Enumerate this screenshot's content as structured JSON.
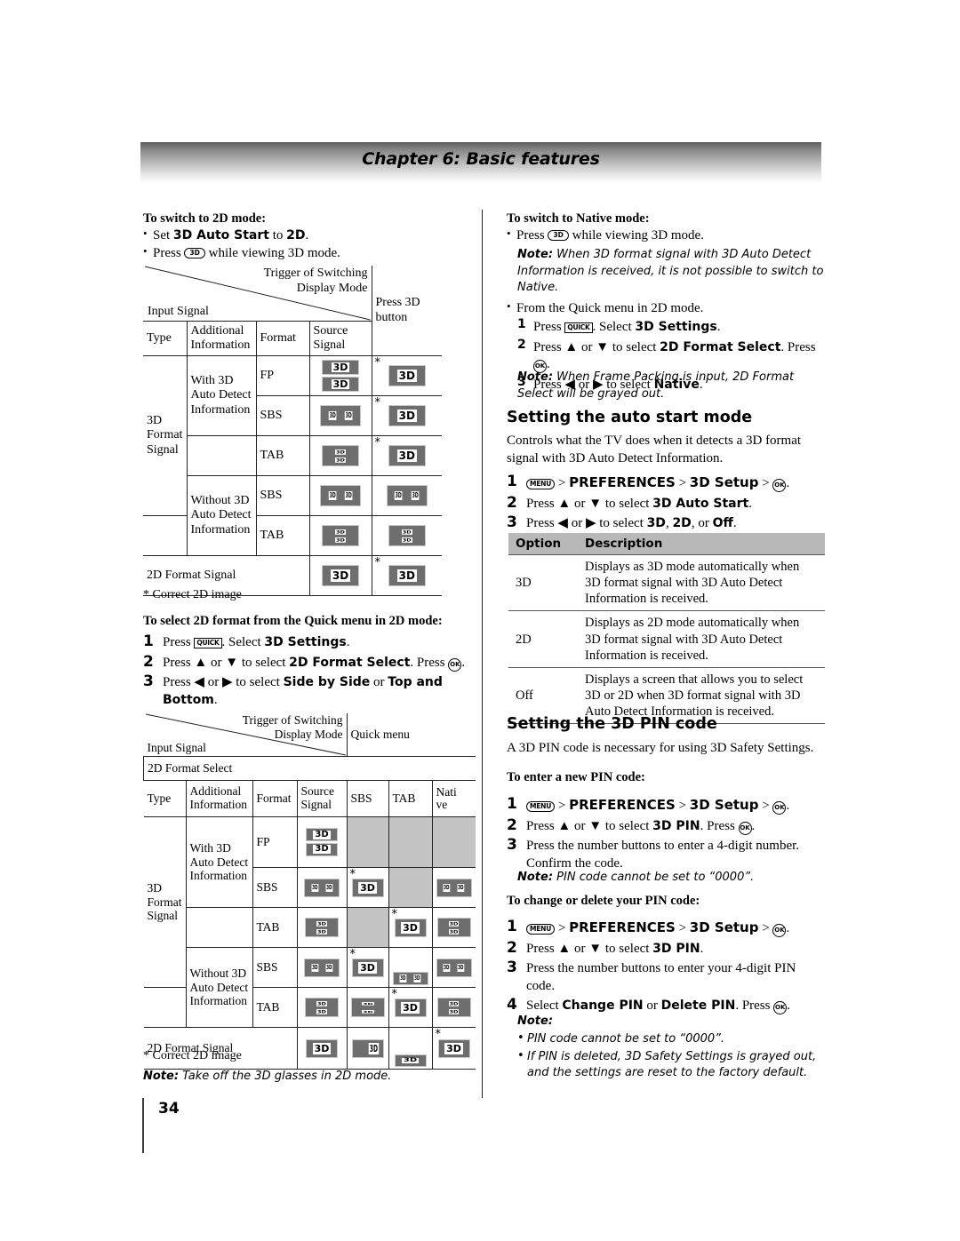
{
  "header": {
    "chapter_title": "Chapter 6: Basic features"
  },
  "page_number": "34",
  "left": {
    "heading_2d": "To switch to 2D mode:",
    "bullet1_a": "Set ",
    "bullet1_b": "3D Auto Start",
    "bullet1_c": " to ",
    "bullet1_d": "2D",
    "bullet1_e": ".",
    "bullet2_a": "Press ",
    "bullet2_key": "3D",
    "bullet2_b": " while viewing 3D mode.",
    "table1": {
      "diag_top": "Trigger of Switching",
      "diag_top2": "Display Mode",
      "diag_bottom": "Input Signal",
      "col_action_a": "Press 3D",
      "col_action_b": "button",
      "sub_headers": [
        "Type",
        "Additional Information",
        "Format",
        "Source Signal"
      ],
      "type_label": "3D Format Signal",
      "info_with": "With 3D Auto Detect Information",
      "info_without": "Without 3D Auto Detect Information",
      "formats": [
        "FP",
        "SBS",
        "TAB",
        "SBS",
        "TAB"
      ],
      "last_row_label": "2D Format Signal",
      "footnote": "* Correct 2D image"
    },
    "heading_quick": "To select 2D format from the Quick menu in 2D mode:",
    "steps": [
      {
        "n": "1",
        "pre": "Press ",
        "key": "QUICK",
        "mid": ". Select ",
        "bold": "3D Settings",
        "post": "."
      },
      {
        "n": "2",
        "pre": "Press ▲ or ▼ to select ",
        "bold": "2D Format Select",
        "mid2": ". Press ",
        "key2": "OK",
        "post": "."
      },
      {
        "n": "3",
        "pre": "Press ◀ or ▶ to select ",
        "bold": "Side by Side",
        "mid2": " or ",
        "bold2": "Top and Bottom",
        "post": "."
      }
    ],
    "table2": {
      "diag_top": "Trigger of Switching",
      "diag_top2": "Display Mode",
      "diag_bottom": "Input Signal",
      "col_action_a": "Quick menu",
      "col_action_b": "2D Format Select",
      "sub_headers": [
        "Type",
        "Additional Information",
        "Format",
        "Source Signal",
        "SBS",
        "TAB",
        "Native"
      ],
      "type_label": "3D Format Signal",
      "info_with": "With 3D Auto Detect Information",
      "info_without": "Without 3D Auto Detect Information",
      "formats": [
        "FP",
        "SBS",
        "TAB",
        "SBS",
        "TAB"
      ],
      "last_row_label": "2D Format Signal",
      "footnote": "* Correct 2D image",
      "note_label": "Note:",
      "note_text": " Take off the 3D glasses in 2D mode."
    }
  },
  "right": {
    "heading_native": "To switch to Native mode:",
    "bullet1_a": "Press ",
    "bullet1_key": "3D",
    "bullet1_b": " while viewing 3D mode.",
    "note1_label": "Note:",
    "note1_text": " When 3D format signal with 3D Auto Detect Information is received, it is not possible to switch to Native.",
    "bullet2": "From the Quick menu in 2D mode.",
    "steps_native": [
      {
        "n": "1",
        "pre": "Press ",
        "key": "QUICK",
        "mid": ". Select ",
        "bold": "3D Settings",
        "post": "."
      },
      {
        "n": "2",
        "pre": "Press ▲ or ▼ to select ",
        "bold": "2D Format Select",
        "mid2": ". Press ",
        "key2": "OK",
        "post": "."
      },
      {
        "n": "3",
        "pre": "Press ◀ or ▶ to select ",
        "bold": "Native",
        "post": "."
      }
    ],
    "note2_label": "Note:",
    "note2_text": " When Frame Packing is input, 2D Format Select will be grayed out.",
    "sec_autostart": "Setting the auto start mode",
    "autostart_body": "Controls what the TV does when it detects a 3D format signal with 3D Auto Detect Information.",
    "autostart_steps": [
      {
        "n": "1",
        "key": "MENU",
        "pre": " > ",
        "bold": "PREFERENCES",
        "mid": " > ",
        "bold2": "3D Setup",
        "mid2": " > ",
        "key2": "OK",
        "post": "."
      },
      {
        "n": "2",
        "pre": "Press ▲ or ▼ to select ",
        "bold": "3D Auto Start",
        "post": "."
      },
      {
        "n": "3",
        "pre": "Press ◀ or ▶ to select ",
        "bold": "3D",
        "mid": ", ",
        "bold2": "2D",
        "mid2": ", or ",
        "bold3": "Off",
        "post": "."
      }
    ],
    "option_table": {
      "headers": [
        "Option",
        "Description"
      ],
      "rows": [
        {
          "option": "3D",
          "description": "Displays as 3D mode automatically when 3D format signal with 3D Auto Detect Information is received."
        },
        {
          "option": "2D",
          "description": "Displays as 2D mode automatically when 3D format signal with 3D Auto Detect Information is received."
        },
        {
          "option": "Off",
          "description": "Displays a screen that allows you to select 3D or 2D when 3D format signal with 3D Auto Detect Information is received."
        }
      ]
    },
    "sec_pin": "Setting the 3D PIN code",
    "pin_body": "A 3D PIN code is necessary for using 3D Safety Settings.",
    "pin_new_heading": "To enter a new PIN code:",
    "pin_new_steps": [
      {
        "n": "1",
        "key": "MENU",
        "pre": " > ",
        "bold": "PREFERENCES",
        "mid": " > ",
        "bold2": "3D Setup",
        "mid2": " > ",
        "key2": "OK",
        "post": "."
      },
      {
        "n": "2",
        "pre": "Press ▲ or ▼ to select ",
        "bold": "3D PIN",
        "mid2": ". Press ",
        "key2": "OK",
        "post": "."
      },
      {
        "n": "3",
        "pre": "Press the number buttons to enter a 4-digit number. Confirm the code."
      }
    ],
    "pin_note_label": "Note:",
    "pin_note_text": " PIN code cannot be set to “0000”.",
    "pin_change_heading": "To change or delete your PIN code:",
    "pin_change_steps": [
      {
        "n": "1",
        "key": "MENU",
        "pre": " > ",
        "bold": "PREFERENCES",
        "mid": " > ",
        "bold2": "3D Setup",
        "mid2": " > ",
        "key2": "OK",
        "post": "."
      },
      {
        "n": "2",
        "pre": "Press ▲ or ▼ to select ",
        "bold": "3D PIN",
        "post": "."
      },
      {
        "n": "3",
        "pre": "Press the number buttons to enter your 4-digit PIN code."
      },
      {
        "n": "4",
        "pre": "Select ",
        "bold": "Change PIN",
        "mid": " or ",
        "bold2": "Delete PIN",
        "mid2": ". Press ",
        "key2": "OK",
        "post": "."
      }
    ],
    "final_note_label": "Note:",
    "final_notes": [
      "PIN code cannot be set to “0000”.",
      "If PIN is deleted, 3D Safety Settings is grayed out, and the settings are reset to the factory default."
    ]
  },
  "colors": {
    "tv_body": "#6e6e6e",
    "shade": "#c4c4c4",
    "option_header": "#b9b9b9"
  }
}
